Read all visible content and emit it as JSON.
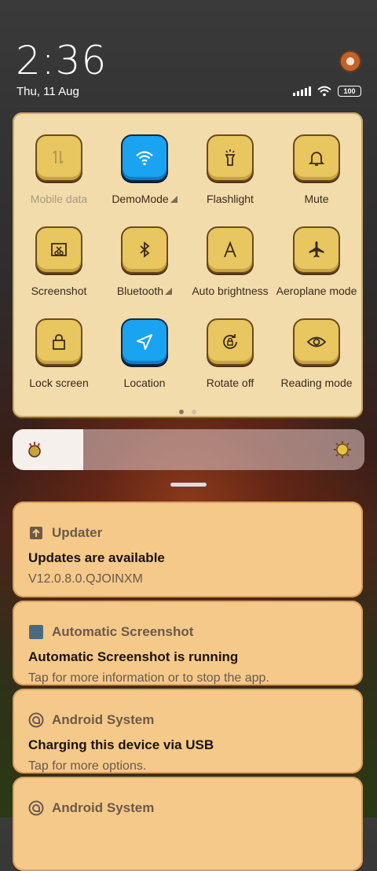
{
  "status": {
    "time": "2:36",
    "date": "Thu, 11 Aug",
    "battery": "100"
  },
  "quick_settings": {
    "tiles": [
      {
        "label": "Mobile data",
        "icon": "mobile-data-icon",
        "active": false,
        "dim": true,
        "caret": false
      },
      {
        "label": "DemoMode",
        "icon": "wifi-icon",
        "active": true,
        "dim": false,
        "caret": true
      },
      {
        "label": "Flashlight",
        "icon": "flashlight-icon",
        "active": false,
        "dim": false,
        "caret": false
      },
      {
        "label": "Mute",
        "icon": "bell-icon",
        "active": false,
        "dim": false,
        "caret": false
      },
      {
        "label": "Screenshot",
        "icon": "screenshot-icon",
        "active": false,
        "dim": false,
        "caret": false
      },
      {
        "label": "Bluetooth",
        "icon": "bluetooth-icon",
        "active": false,
        "dim": false,
        "caret": true
      },
      {
        "label": "Auto brightness",
        "icon": "auto-brightness-icon",
        "active": false,
        "dim": false,
        "caret": false
      },
      {
        "label": "Aeroplane mode",
        "icon": "airplane-icon",
        "active": false,
        "dim": false,
        "caret": false
      },
      {
        "label": "Lock screen",
        "icon": "lock-icon",
        "active": false,
        "dim": false,
        "caret": false
      },
      {
        "label": "Location",
        "icon": "location-icon",
        "active": true,
        "dim": false,
        "caret": false
      },
      {
        "label": "Rotate off",
        "icon": "rotate-lock-icon",
        "active": false,
        "dim": false,
        "caret": false
      },
      {
        "label": "Reading mode",
        "icon": "eye-icon",
        "active": false,
        "dim": false,
        "caret": false
      }
    ],
    "page_count": 2,
    "current_page": 1
  },
  "brightness": {
    "level": 0.2
  },
  "notifications": [
    {
      "app": "Updater",
      "icon": "upload-arrow-icon",
      "title": "Updates are available",
      "body": "V12.0.8.0.QJOINXM"
    },
    {
      "app": "Automatic Screenshot",
      "icon": "app-square-icon",
      "title": "Automatic Screenshot is running",
      "body": "Tap for more information or to stop the app."
    },
    {
      "app": "Android System",
      "icon": "android-system-icon",
      "title": "Charging this device via USB",
      "body": "Tap for more options."
    },
    {
      "app": "Android System",
      "icon": "android-system-icon",
      "title": "",
      "body": ""
    }
  ],
  "colors": {
    "panel": "#f2dcab",
    "tile": "#e8c660",
    "tile_active": "#1aa3f0",
    "notification": "#f5c98a"
  }
}
